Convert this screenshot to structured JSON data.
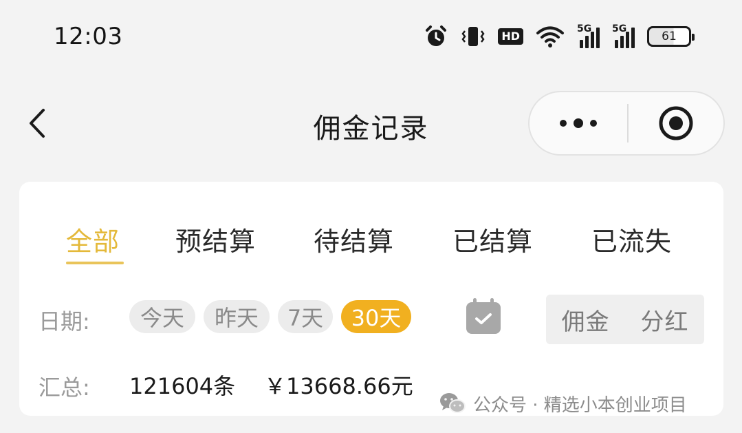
{
  "status_bar": {
    "time": "12:03",
    "hd_label": "HD",
    "signal_1_tag": "5G",
    "signal_2_tag": "5G",
    "battery_level": "61",
    "icons": [
      "alarm-icon",
      "vibrate-icon",
      "hd-voice-icon",
      "wifi-icon",
      "signal-icon",
      "signal-icon",
      "battery-icon"
    ]
  },
  "nav": {
    "title": "佣金记录",
    "icons": [
      "back-chevron-icon",
      "more-dots-icon",
      "close-target-icon"
    ]
  },
  "tabs": [
    {
      "label": "全部",
      "active": true
    },
    {
      "label": "预结算",
      "active": false
    },
    {
      "label": "待结算",
      "active": false
    },
    {
      "label": "已结算",
      "active": false
    },
    {
      "label": "已流失",
      "active": false
    }
  ],
  "date_filter": {
    "label": "日期:",
    "chips": [
      {
        "label": "今天",
        "active": false
      },
      {
        "label": "昨天",
        "active": false
      },
      {
        "label": "7天",
        "active": false
      },
      {
        "label": "30天",
        "active": true
      }
    ],
    "calendar_icon": "calendar-check-icon"
  },
  "type_toggle": {
    "options": [
      "佣金",
      "分红"
    ]
  },
  "summary": {
    "label": "汇总:",
    "count": "121604条",
    "amount": "￥13668.66元"
  },
  "watermark": {
    "text": "公众号 · 精选小本创业项目",
    "icon": "wechat-icon"
  },
  "colors": {
    "accent": "#e4b93a",
    "chip_active": "#f1b020",
    "background": "#f3f3f3"
  }
}
